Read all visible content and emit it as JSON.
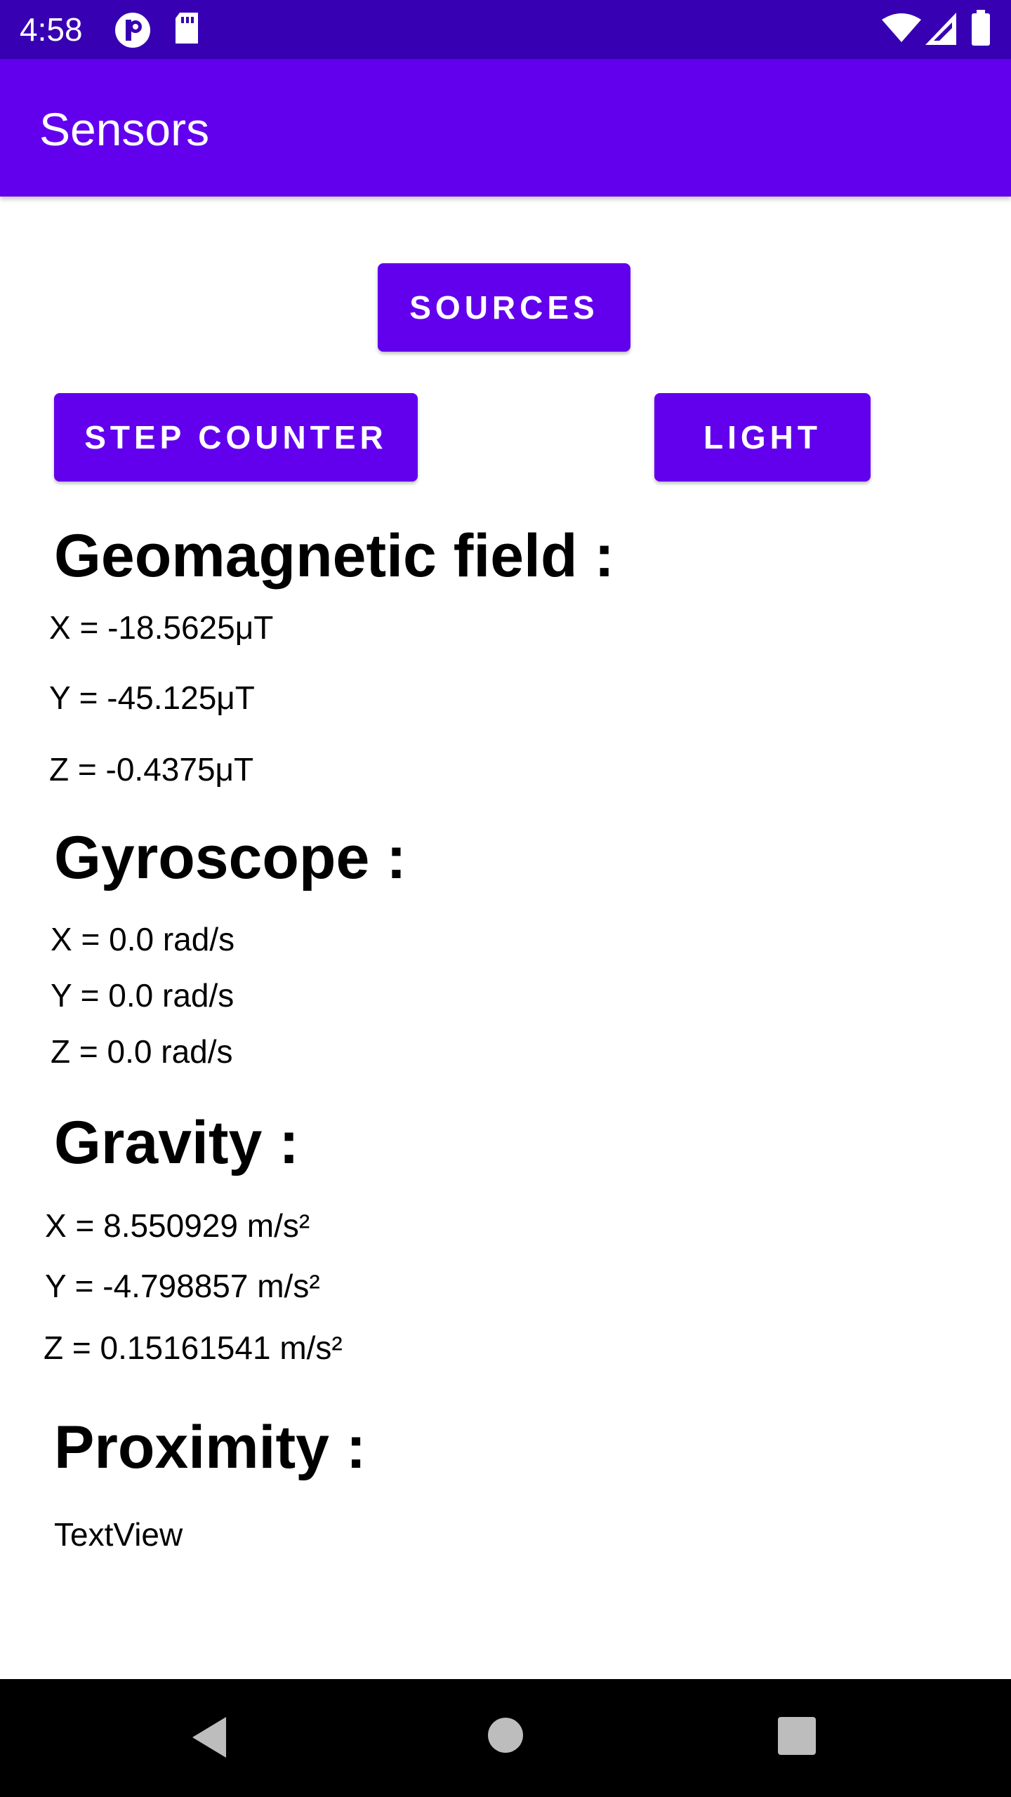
{
  "status_bar": {
    "time": "4:58",
    "icons": [
      "p-app-icon",
      "sd-card-icon",
      "wifi-icon",
      "signal-icon",
      "battery-icon"
    ]
  },
  "app_bar": {
    "title": "Sensors"
  },
  "buttons": {
    "sources": "SOURCES",
    "step_counter": "STEP COUNTER",
    "light": "LIGHT"
  },
  "geomagnetic": {
    "heading": "Geomagnetic field :",
    "x": "X = -18.5625μT",
    "y": "Y = -45.125μT",
    "z": "Z = -0.4375μT"
  },
  "gyroscope": {
    "heading": "Gyroscope :",
    "x": "X = 0.0 rad/s",
    "y": "Y = 0.0 rad/s",
    "z": "Z = 0.0 rad/s"
  },
  "gravity": {
    "heading": "Gravity :",
    "x": "X = 8.550929 m/s²",
    "y": "Y = -4.798857 m/s²",
    "z": "Z = 0.15161541 m/s²"
  },
  "proximity": {
    "heading": "Proximity :",
    "value": "TextView"
  },
  "colors": {
    "status_bar": "#3700B3",
    "primary": "#6200EE",
    "nav_bar": "#000000",
    "nav_icon": "#bdbdbd"
  },
  "nav": [
    "back-icon",
    "home-icon",
    "recents-icon"
  ]
}
